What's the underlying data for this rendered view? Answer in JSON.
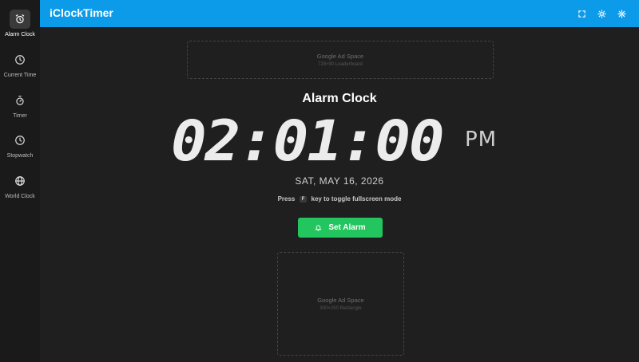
{
  "app": {
    "title": "iClockTimer"
  },
  "sidebar": {
    "items": [
      {
        "label": "Alarm Clock",
        "icon": "alarm-clock-icon",
        "active": true
      },
      {
        "label": "Current Time",
        "icon": "clock-icon",
        "active": false
      },
      {
        "label": "Timer",
        "icon": "stopwatch-icon",
        "active": false
      },
      {
        "label": "Stopwatch",
        "icon": "clock-icon",
        "active": false
      },
      {
        "label": "World Clock",
        "icon": "globe-icon",
        "active": false
      }
    ]
  },
  "header": {
    "buttons": [
      {
        "icon": "fullscreen-icon"
      },
      {
        "icon": "sun-icon"
      },
      {
        "icon": "gear-icon"
      }
    ]
  },
  "ads": {
    "top": {
      "title": "Google Ad Space",
      "subtitle": "728×90 Leaderboard"
    },
    "bottom": {
      "title": "Google Ad Space",
      "subtitle": "300×250 Rectangle"
    }
  },
  "main": {
    "title": "Alarm Clock",
    "time": "02:01:00",
    "ampm": "PM",
    "date": "SAT, MAY 16, 2026",
    "hint_prefix": "Press",
    "hint_key": "F",
    "hint_suffix": "key to toggle fullscreen mode",
    "set_alarm_label": "Set Alarm"
  },
  "colors": {
    "header_bg": "#0c9be8",
    "page_bg": "#1f1f1f",
    "sidebar_bg": "#1a1a1a",
    "accent_green": "#22c55e"
  }
}
